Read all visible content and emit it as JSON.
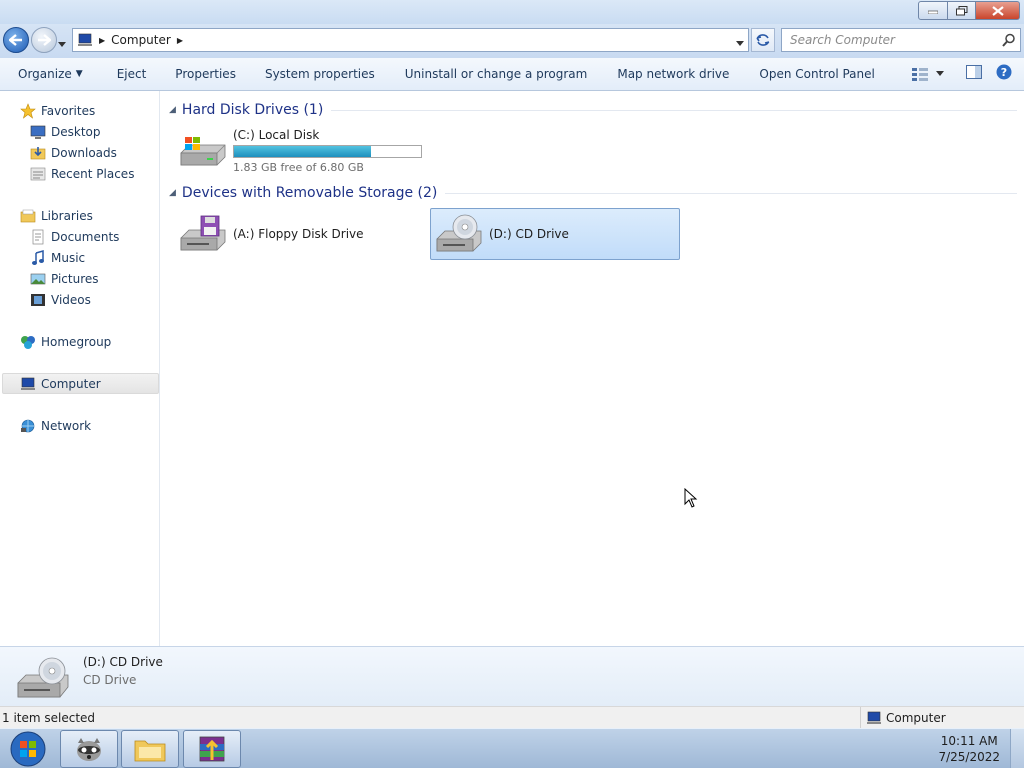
{
  "address": {
    "crumb": "Computer",
    "search_placeholder": "Search Computer"
  },
  "toolbar": {
    "organize": "Organize",
    "eject": "Eject",
    "properties": "Properties",
    "system_properties": "System properties",
    "uninstall": "Uninstall or change a program",
    "map_drive": "Map network drive",
    "control_panel": "Open Control Panel"
  },
  "nav": {
    "favorites": "Favorites",
    "desktop": "Desktop",
    "downloads": "Downloads",
    "recent_places": "Recent Places",
    "libraries": "Libraries",
    "documents": "Documents",
    "music": "Music",
    "pictures": "Pictures",
    "videos": "Videos",
    "homegroup": "Homegroup",
    "computer": "Computer",
    "network": "Network"
  },
  "groups": {
    "hdd_title": "Hard Disk Drives (1)",
    "removable_title": "Devices with Removable Storage (2)"
  },
  "drives": {
    "c_name": "(C:) Local Disk",
    "c_free": "1.83 GB free of 6.80 GB",
    "c_used_fraction": 0.731,
    "a_name": "(A:) Floppy Disk Drive",
    "d_name": "(D:) CD Drive"
  },
  "details": {
    "name": "(D:) CD Drive",
    "type": "CD Drive"
  },
  "status": {
    "selected": "1 item selected",
    "location": "Computer"
  },
  "taskbar": {
    "time": "10:11 AM",
    "date": "7/25/2022"
  },
  "colors": {
    "accent": "#1e3287",
    "selection": "#c1dcf9",
    "capacity": "#1e8fbd"
  }
}
